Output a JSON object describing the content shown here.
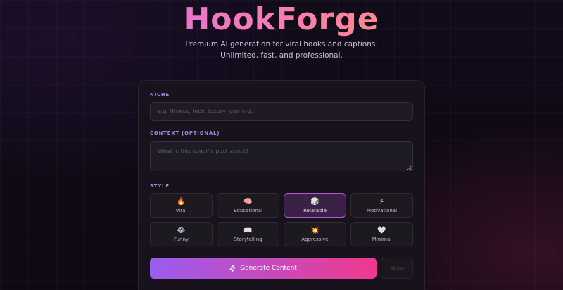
{
  "header": {
    "logo_text": "HookForge",
    "subtitle_line1": "Premium AI generation for viral hooks and captions.",
    "subtitle_line2": "Unlimited, fast, and professional."
  },
  "form": {
    "niche": {
      "label": "NICHE",
      "value": "",
      "placeholder": "e.g. fitness, tech, luxury, gaming..."
    },
    "context": {
      "label": "CONTEXT (OPTIONAL)",
      "value": "",
      "placeholder": "What is this specific post about?"
    },
    "style": {
      "label": "STYLE",
      "selected": "Relatable",
      "options": [
        {
          "label": "Viral",
          "icon": "fire-icon",
          "glyph": "🔥"
        },
        {
          "label": "Educational",
          "icon": "brain-icon",
          "glyph": "🧠"
        },
        {
          "label": "Relatable",
          "icon": "dice-icon",
          "glyph": "🎲"
        },
        {
          "label": "Motivational",
          "icon": "lightning-icon",
          "glyph": "⚡"
        },
        {
          "label": "Funny",
          "icon": "laughing-face-icon",
          "glyph": "😂"
        },
        {
          "label": "Storytelling",
          "icon": "open-book-icon",
          "glyph": "📖"
        },
        {
          "label": "Aggressive",
          "icon": "explosion-icon",
          "glyph": "💥"
        },
        {
          "label": "Minimal",
          "icon": "white-heart-icon",
          "glyph": "🤍"
        }
      ]
    },
    "generate_label": "Generate Content",
    "generate_icon": "lightning-icon",
    "more_label": "More"
  },
  "colors": {
    "accent_start": "#9b5cf0",
    "accent_end": "#ee3a8c",
    "label": "#a58be0",
    "selected_border": "#b05ad9"
  }
}
